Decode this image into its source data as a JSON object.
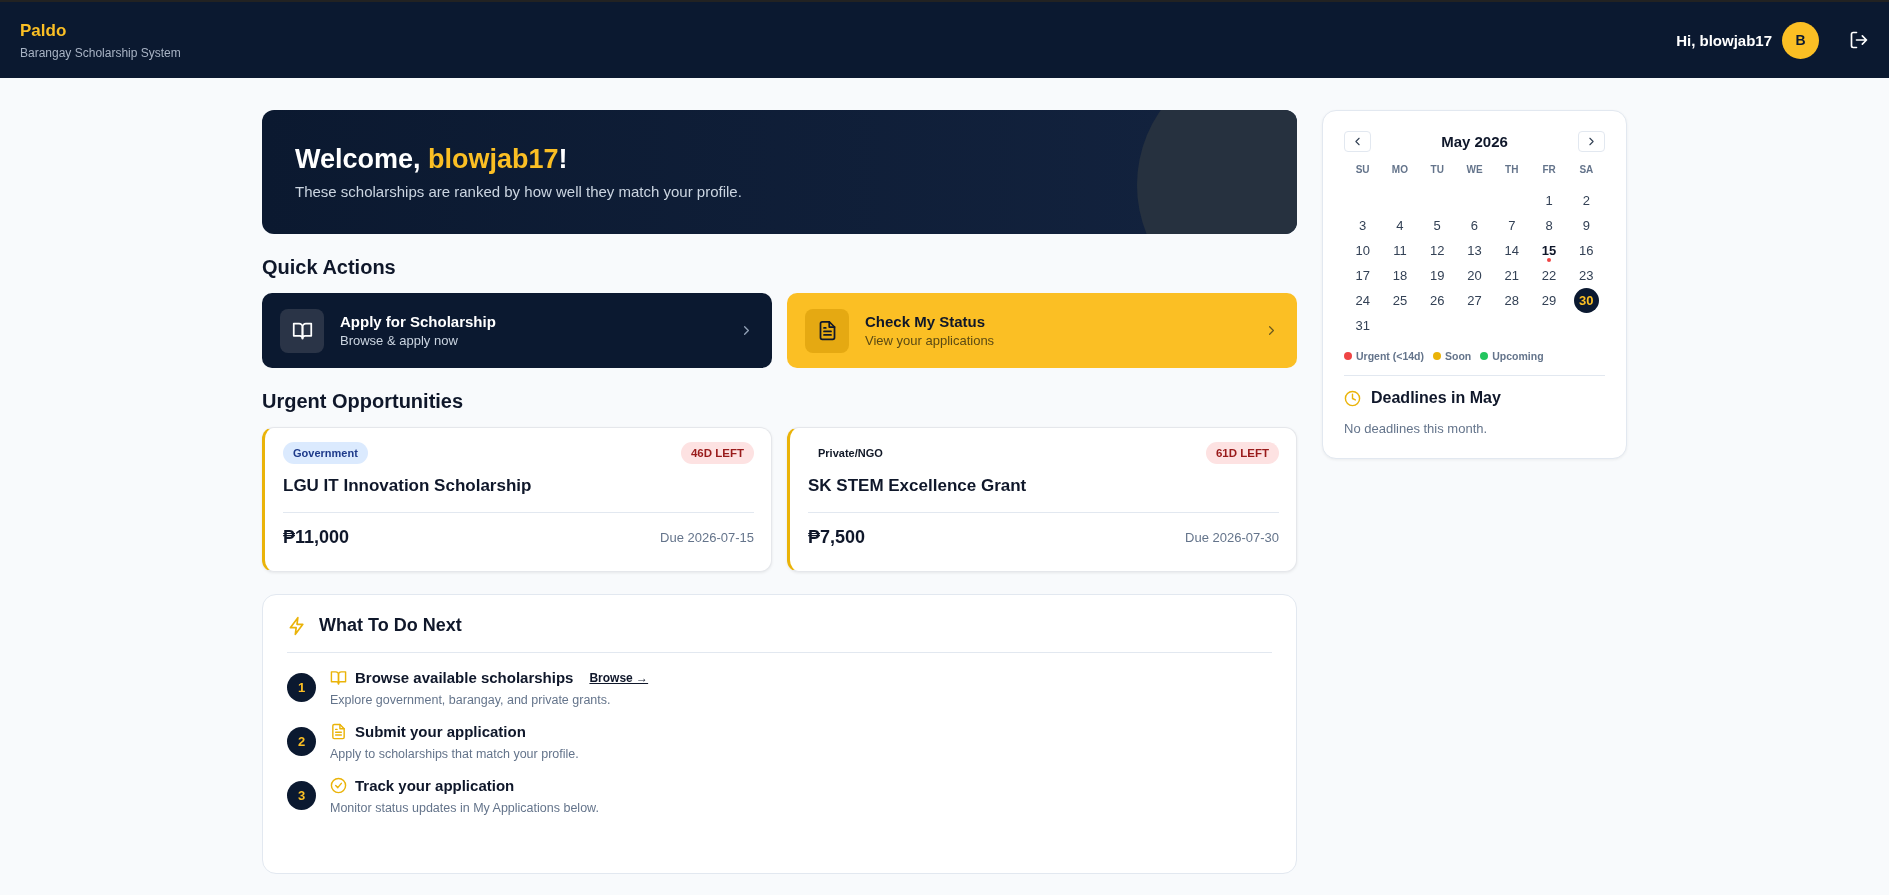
{
  "header": {
    "brand": "Paldo",
    "subtitle": "Barangay Scholarship System",
    "greeting": "Hi, blowjab17",
    "avatar": "B"
  },
  "welcome": {
    "prefix": "Welcome, ",
    "name": "blowjab17",
    "suffix": "!",
    "text": "These scholarships are ranked by how well they match your profile."
  },
  "quick_actions": {
    "title": "Quick Actions",
    "items": [
      {
        "kind": "dark",
        "title": "Apply for Scholarship",
        "subtitle": "Browse & apply now"
      },
      {
        "kind": "accent",
        "title": "Check My Status",
        "subtitle": "View your applications"
      }
    ]
  },
  "urgent": {
    "title": "Urgent Opportunities",
    "cards": [
      {
        "category": "Government",
        "kind": "pill",
        "days_left": "46D LEFT",
        "name": "LGU IT Innovation Scholarship",
        "amount": "₱11,000",
        "due": "Due 2026-07-15"
      },
      {
        "category": "Private/NGO",
        "kind": "plain",
        "days_left": "61D LEFT",
        "name": "SK STEM Excellence Grant",
        "amount": "₱7,500",
        "due": "Due 2026-07-30"
      }
    ]
  },
  "next_steps": {
    "title": "What To Do Next",
    "steps": [
      {
        "number": "1",
        "title": "Browse available scholarships",
        "link": "Browse →",
        "description": "Explore government, barangay, and private grants."
      },
      {
        "number": "2",
        "title": "Submit your application",
        "description": "Apply to scholarships that match your profile."
      },
      {
        "number": "3",
        "title": "Track your application",
        "description": "Monitor status updates in My Applications below."
      }
    ]
  },
  "calendar": {
    "month": "May 2026",
    "weekdays": [
      "SU",
      "MO",
      "TU",
      "WE",
      "TH",
      "FR",
      "SA"
    ],
    "weeks": [
      [
        {
          "day": "1",
          "today": false
        },
        {
          "day": "2",
          "today": false
        }
      ],
      [
        {
          "day": "3",
          "today": false
        },
        {
          "day": "4",
          "today": false
        },
        {
          "day": "5",
          "today": false
        },
        {
          "day": "6",
          "today": false
        },
        {
          "day": "7",
          "today": false
        },
        {
          "day": "8",
          "today": false
        },
        {
          "day": "9",
          "today": false
        }
      ],
      [
        {
          "day": "10",
          "today": false
        },
        {
          "day": "11",
          "today": false
        },
        {
          "day": "12",
          "today": false
        },
        {
          "day": "13",
          "today": false
        },
        {
          "day": "14",
          "today": false
        },
        {
          "day": "15",
          "today": false,
          "color": "#ef4444"
        },
        {
          "day": "16",
          "today": false
        }
      ],
      [
        {
          "day": "17",
          "today": false
        },
        {
          "day": "18",
          "today": false
        },
        {
          "day": "19",
          "today": false
        },
        {
          "day": "20",
          "today": false
        },
        {
          "day": "21",
          "today": false
        },
        {
          "day": "22",
          "today": false
        },
        {
          "day": "23",
          "today": false
        }
      ],
      [
        {
          "day": "24",
          "today": false
        },
        {
          "day": "25",
          "today": false
        },
        {
          "day": "26",
          "today": false
        },
        {
          "day": "27",
          "today": false
        },
        {
          "day": "28",
          "today": false
        },
        {
          "day": "29",
          "today": false
        },
        {
          "day": "30",
          "today": true
        }
      ],
      [
        {
          "day": "31",
          "today": false
        }
      ]
    ],
    "legend": [
      {
        "label": "Urgent (<14d)",
        "color": "#ef4444"
      },
      {
        "label": "Soon",
        "color": "#eab308"
      },
      {
        "label": "Upcoming",
        "color": "#22c55e"
      }
    ],
    "deadlines_title": "Deadlines in May",
    "deadlines_empty": "No deadlines this month."
  }
}
